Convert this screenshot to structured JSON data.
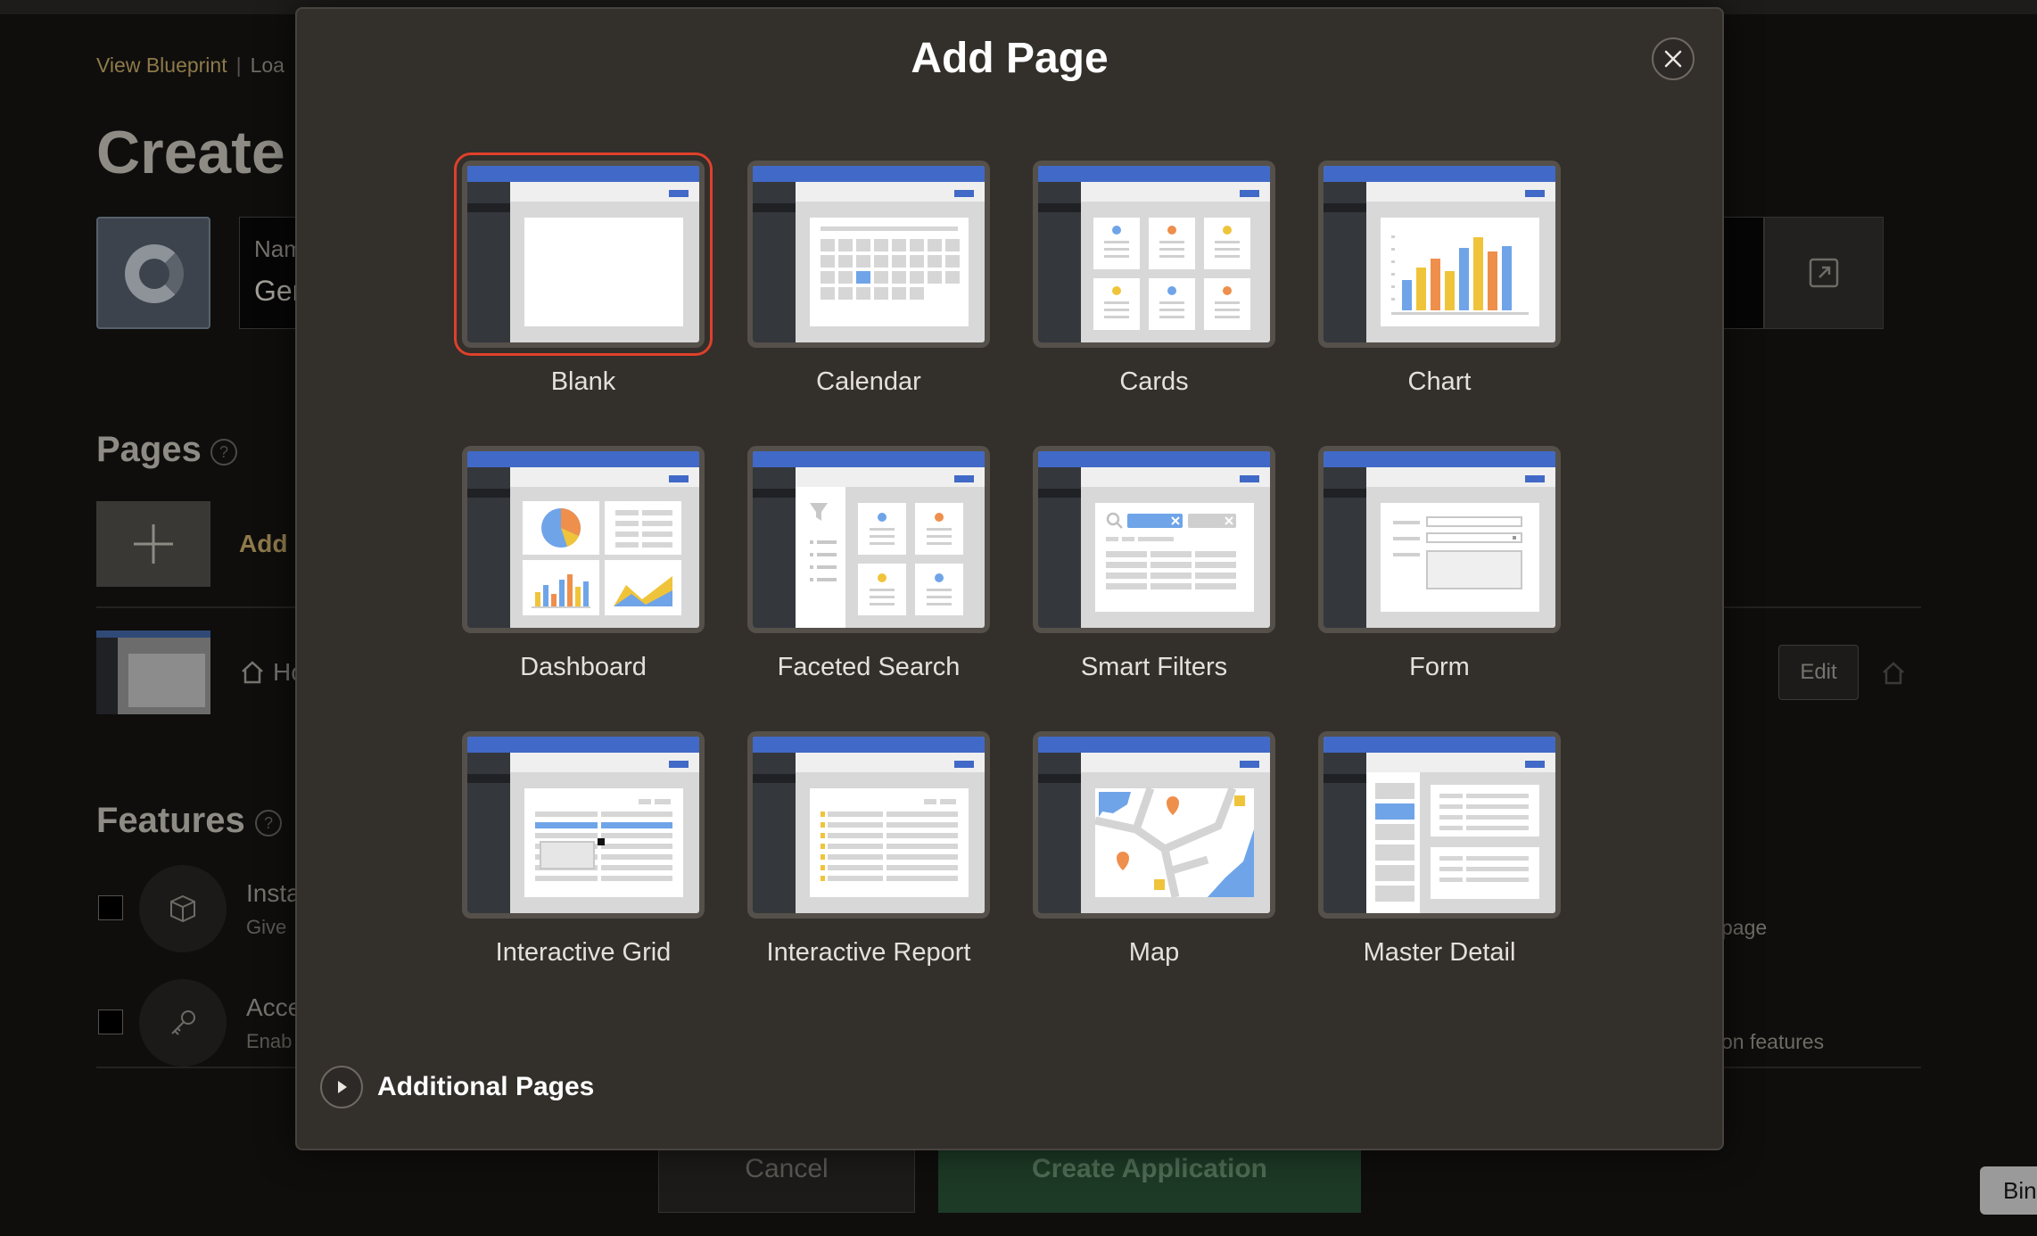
{
  "background": {
    "breadcrumb": {
      "view_blueprint": "View Blueprint",
      "load": "Loa"
    },
    "page_title": "Create a",
    "name_field": {
      "label": "Nam",
      "value": "Ger"
    },
    "pages_heading": "Pages",
    "add_label": "Add",
    "home_page_label": "Ho",
    "edit_label": "Edit",
    "features_heading": "Features",
    "features": [
      {
        "title": "Insta",
        "description": "Give",
        "right_text": "page"
      },
      {
        "title": "Acce",
        "description": "Enab",
        "right_text": "on features"
      }
    ],
    "cancel_label": "Cancel",
    "create_label": "Create Application",
    "tooltip_text": "Bin"
  },
  "dialog": {
    "title": "Add Page",
    "close_label": "Close",
    "page_types": [
      {
        "label": "Blank",
        "icon": "blank-page-icon",
        "selected": true
      },
      {
        "label": "Calendar",
        "icon": "calendar-icon",
        "selected": false
      },
      {
        "label": "Cards",
        "icon": "cards-icon",
        "selected": false
      },
      {
        "label": "Chart",
        "icon": "chart-icon",
        "selected": false
      },
      {
        "label": "Dashboard",
        "icon": "dashboard-icon",
        "selected": false
      },
      {
        "label": "Faceted Search",
        "icon": "faceted-search-icon",
        "selected": false
      },
      {
        "label": "Smart Filters",
        "icon": "smart-filters-icon",
        "selected": false
      },
      {
        "label": "Form",
        "icon": "form-icon",
        "selected": false
      },
      {
        "label": "Interactive Grid",
        "icon": "interactive-grid-icon",
        "selected": false
      },
      {
        "label": "Interactive Report",
        "icon": "interactive-report-icon",
        "selected": false
      },
      {
        "label": "Map",
        "icon": "map-icon",
        "selected": false
      },
      {
        "label": "Master Detail",
        "icon": "master-detail-icon",
        "selected": false
      }
    ],
    "additional_pages_label": "Additional Pages"
  },
  "colors": {
    "accent_blue": "#4169c7",
    "selection_red": "#e0402a",
    "dialog_bg": "#332f2b"
  }
}
